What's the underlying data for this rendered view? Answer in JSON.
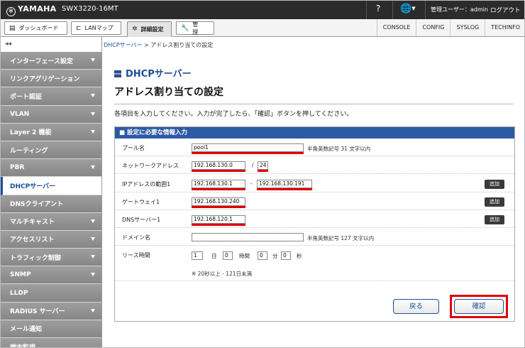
{
  "header": {
    "logo": "YAMAHA",
    "model": "SWX3220-16MT",
    "help_icon": "?",
    "user_label": "管理ユーザー：admin",
    "logout": "ログアウト"
  },
  "tabs": [
    {
      "label": "ダッシュボード",
      "icon": "dashboard-icon"
    },
    {
      "label": "LANマップ",
      "icon": "lan-map-icon"
    },
    {
      "label": "詳細設定",
      "icon": "gear-icon"
    },
    {
      "label": "管　理",
      "icon": "wrench-icon"
    }
  ],
  "sublinks": [
    "CONSOLE",
    "CONFIG",
    "SYSLOG",
    "TECHINFO"
  ],
  "sidebar": {
    "collapse": "◂◂",
    "items": [
      {
        "label": "インターフェース設定",
        "arrow": true
      },
      {
        "label": "リンクアグリゲーション",
        "arrow": false
      },
      {
        "label": "ポート認証",
        "arrow": true
      },
      {
        "label": "VLAN",
        "arrow": true
      },
      {
        "label": "Layer 2 機能",
        "arrow": true
      },
      {
        "label": "ルーティング",
        "arrow": false
      },
      {
        "label": "PBR",
        "arrow": true
      },
      {
        "label": "DHCPサーバー",
        "arrow": false,
        "active": true
      },
      {
        "label": "DNSクライアント",
        "arrow": false
      },
      {
        "label": "マルチキャスト",
        "arrow": true
      },
      {
        "label": "アクセスリスト",
        "arrow": true
      },
      {
        "label": "トラフィック制御",
        "arrow": true
      },
      {
        "label": "SNMP",
        "arrow": true
      },
      {
        "label": "LLDP",
        "arrow": false
      },
      {
        "label": "RADIUS サーバー",
        "arrow": true
      },
      {
        "label": "メール通知",
        "arrow": false
      },
      {
        "label": "端末監視",
        "arrow": false
      }
    ]
  },
  "breadcrumb": {
    "link": "DHCPサーバー",
    "sep": " > ",
    "current": "アドレス割り当ての設定"
  },
  "main": {
    "category": "DHCPサーバー",
    "title": "アドレス割り当ての設定",
    "instruction": "各項目を入力してください。入力が完了したら、「確認」ボタンを押してください。",
    "panel_title": "■ 設定に必要な情報入力",
    "form": {
      "pool_label": "プール名",
      "pool_value": "pool1",
      "pool_hint": "半角英数記号 31 文字以内",
      "network_label": "ネットワークアドレス",
      "network_value": "192.168.130.0",
      "prefix_sep": "/",
      "prefix_value": "24",
      "range_label": "IPアドレスの範囲1",
      "range_start": "192.168.130.1",
      "range_sep": "-",
      "range_end": "192.168.130.191",
      "gateway_label": "ゲートウェイ1",
      "gateway_value": "192.168.130.240",
      "dns_label": "DNSサーバー1",
      "dns_value": "192.168.120.1",
      "domain_label": "ドメイン名",
      "domain_value": "",
      "domain_hint": "半角英数記号 127 文字以内",
      "lease_label": "リース時間",
      "lease_days": "1",
      "lease_days_unit": "日",
      "lease_hours": "0",
      "lease_hours_unit": "時間",
      "lease_minutes": "0",
      "lease_minutes_unit": "分",
      "lease_seconds": "0",
      "lease_seconds_unit": "秒",
      "lease_note": "※ 20秒以上 - 121日未満",
      "add_label": "追加"
    },
    "back_button": "戻る",
    "confirm_button": "確認"
  },
  "colors": {
    "accent_blue": "#2d5aa5",
    "highlight_red": "#e00000",
    "sidebar_gray": "#8f8f8f"
  }
}
